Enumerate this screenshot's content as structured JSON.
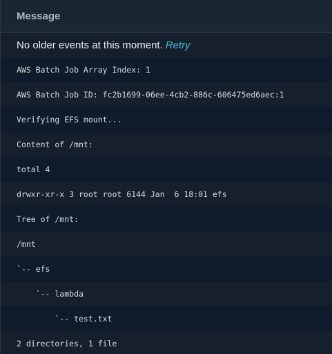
{
  "header": {
    "column_title": "Message"
  },
  "notice": {
    "text": "No older events at this moment.",
    "retry_label": "Retry"
  },
  "messages": [
    "AWS Batch Job Array Index: 1",
    "AWS Batch Job ID: fc2b1699-06ee-4cb2-886c-606475ed6aec:1",
    "Verifying EFS mount...",
    "Content of /mnt:",
    "total 4",
    "drwxr-xr-x 3 root root 6144 Jan  6 18:01 efs",
    "Tree of /mnt:",
    "/mnt",
    "`-- efs",
    "    `-- lambda",
    "        `-- test.txt",
    "2 directories, 1 file"
  ],
  "colors": {
    "background": "#0f1b2a",
    "alt_row": "#16202c",
    "header": "#1b2633",
    "link": "#44b9d6"
  }
}
